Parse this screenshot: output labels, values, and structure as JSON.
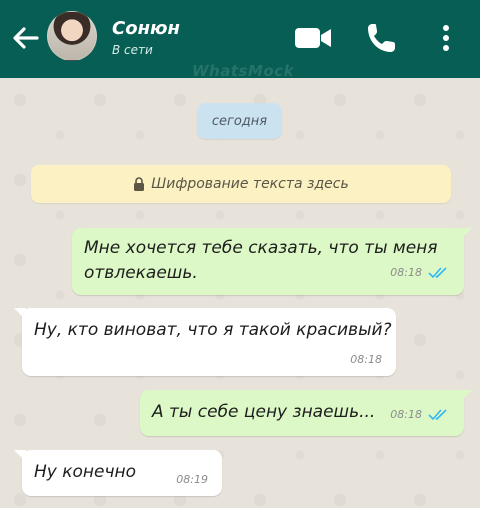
{
  "header": {
    "contact_name": "Сонюн",
    "status": "В сети",
    "watermark": "WhatsMock",
    "icons": [
      "back-arrow-icon",
      "video-camera-icon",
      "phone-icon",
      "more-vert-icon"
    ]
  },
  "date_label": "сегодня",
  "encryption_notice": "Шифрование текста здесь",
  "messages": [
    {
      "direction": "out",
      "text_line1": "Мне хочется тебе сказать, что ты меня",
      "text_line2": "отвлекаешь.",
      "time": "08:18",
      "read": true
    },
    {
      "direction": "in",
      "text": "Ну, кто виноват, что я такой красивый?",
      "time": "08:18"
    },
    {
      "direction": "out",
      "text": "А ты себе цену знаешь...",
      "time": "08:18",
      "read": true
    },
    {
      "direction": "in",
      "text": "Ну конечно",
      "time": "08:19"
    }
  ],
  "colors": {
    "header": "#075e54",
    "outgoing_bubble": "#dcf8c6",
    "incoming_bubble": "#ffffff",
    "read_ticks": "#34b7f1",
    "date_pill": "#cbe2f1",
    "encryption_bg": "#fbf1c3"
  }
}
